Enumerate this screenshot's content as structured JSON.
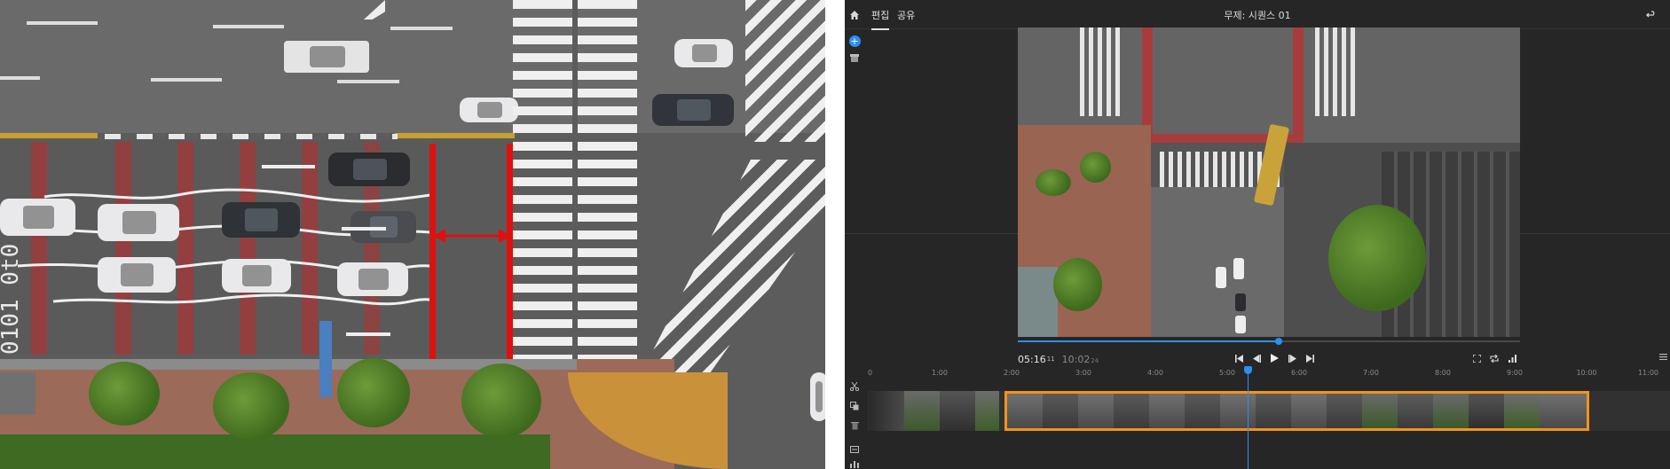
{
  "left_photo": {
    "road_markings": [
      "0101 0t0",
      "0101 0t0"
    ]
  },
  "editor": {
    "header": {
      "home_icon": "home-icon",
      "tabs": [
        {
          "label": "편집",
          "active": true
        },
        {
          "label": "공유",
          "active": false
        }
      ],
      "title": "무제: 시퀀스 01",
      "undo_icon": "undo-icon"
    },
    "side_tools": {
      "top": [
        "add-media-icon",
        "archive-icon"
      ],
      "bottom": [
        "scissors-icon",
        "duplicate-icon",
        "trash-icon",
        "caption-icon",
        "audio-icon"
      ]
    },
    "player": {
      "current_time": "05:16",
      "current_frames": "11",
      "total_time": "10:02",
      "total_frames": "24",
      "progress": 0.52,
      "controls": [
        "skip-start-icon",
        "step-back-icon",
        "play-icon",
        "step-forward-icon",
        "skip-end-icon"
      ],
      "right_tools": [
        "fit-icon",
        "loop-icon",
        "volume-icon"
      ],
      "menu_icon": "menu-icon"
    },
    "timeline": {
      "ticks": [
        "0",
        "1:00",
        "2:00",
        "3:00",
        "4:00",
        "5:00",
        "6:00",
        "7:00",
        "8:00",
        "9:00",
        "10:00",
        "11:00"
      ],
      "playhead_time": "5:16"
    },
    "colors": {
      "accent": "#2d8ff0",
      "clip_border": "#f2931c",
      "background": "#262626"
    }
  }
}
